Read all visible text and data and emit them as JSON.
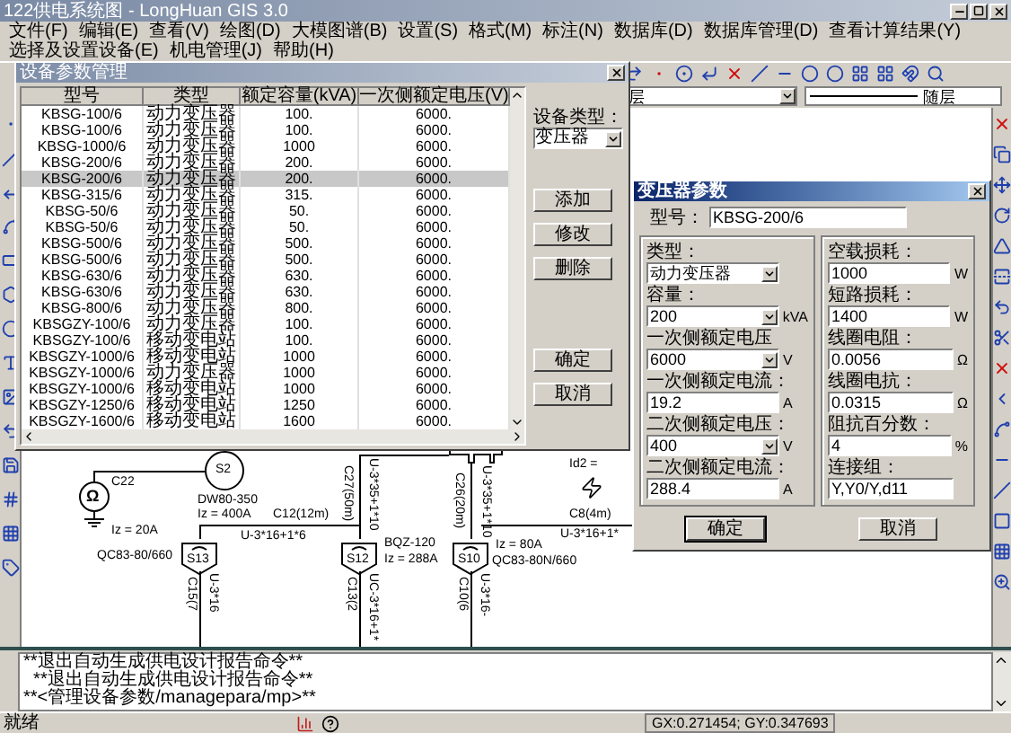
{
  "window": {
    "title": "122供电系统图 - LongHuan GIS 3.0"
  },
  "menu": [
    "文件(F)",
    "编辑(E)",
    "查看(V)",
    "绘图(D)",
    "大模图谱(B)",
    "设置(S)",
    "格式(M)",
    "标注(N)",
    "数据库(D)",
    "数据库管理(D)",
    "查看计算结果(Y)",
    "选择及设置设备(E)",
    "机电管理(J)",
    "帮助(H)"
  ],
  "layer_bar": {
    "layer": "层",
    "linetype": "随层"
  },
  "equipment_dialog": {
    "title": "设备参数管理",
    "columns": [
      "型号",
      "类型",
      "额定容量(kVA)",
      "一次侧额定电压(V)"
    ],
    "rows": [
      {
        "cells": [
          "KBSG-100/6",
          "动力变压器",
          "100.",
          "6000."
        ],
        "selected": false
      },
      {
        "cells": [
          "KBSG-100/6",
          "动力变压器",
          "100.",
          "6000."
        ],
        "selected": false
      },
      {
        "cells": [
          "KBSG-1000/6",
          "动力变压器",
          "1000",
          "6000."
        ],
        "selected": false
      },
      {
        "cells": [
          "KBSG-200/6",
          "动力变压器",
          "200.",
          "6000."
        ],
        "selected": false
      },
      {
        "cells": [
          "KBSG-200/6",
          "动力变压器",
          "200.",
          "6000."
        ],
        "selected": true
      },
      {
        "cells": [
          "KBSG-315/6",
          "动力变压器",
          "315.",
          "6000."
        ],
        "selected": false
      },
      {
        "cells": [
          "KBSG-50/6",
          "动力变压器",
          "50.",
          "6000."
        ],
        "selected": false
      },
      {
        "cells": [
          "KBSG-50/6",
          "动力变压器",
          "50.",
          "6000."
        ],
        "selected": false
      },
      {
        "cells": [
          "KBSG-500/6",
          "动力变压器",
          "500.",
          "6000."
        ],
        "selected": false
      },
      {
        "cells": [
          "KBSG-500/6",
          "动力变压器",
          "500.",
          "6000."
        ],
        "selected": false
      },
      {
        "cells": [
          "KBSG-630/6",
          "动力变压器",
          "630.",
          "6000."
        ],
        "selected": false
      },
      {
        "cells": [
          "KBSG-630/6",
          "动力变压器",
          "630.",
          "6000."
        ],
        "selected": false
      },
      {
        "cells": [
          "KBSG-800/6",
          "动力变压器",
          "800.",
          "6000."
        ],
        "selected": false
      },
      {
        "cells": [
          "KBSGZY-100/6",
          "动力变压器",
          "100.",
          "6000."
        ],
        "selected": false
      },
      {
        "cells": [
          "KBSGZY-100/6",
          "移动变电站",
          "100.",
          "6000."
        ],
        "selected": false
      },
      {
        "cells": [
          "KBSGZY-1000/6",
          "移动变电站",
          "1000",
          "6000."
        ],
        "selected": false
      },
      {
        "cells": [
          "KBSGZY-1000/6",
          "动力变压器",
          "1000",
          "6000."
        ],
        "selected": false
      },
      {
        "cells": [
          "KBSGZY-1000/6",
          "移动变电站",
          "1000",
          "6000."
        ],
        "selected": false
      },
      {
        "cells": [
          "KBSGZY-1250/6",
          "移动变电站",
          "1250",
          "6000."
        ],
        "selected": false
      },
      {
        "cells": [
          "KBSGZY-1600/6",
          "移动变电站",
          "1600",
          "6000."
        ],
        "selected": false
      }
    ],
    "type_label": "设备类型：",
    "type_value": "变压器",
    "buttons": [
      "添加",
      "修改",
      "删除"
    ],
    "footer_buttons": [
      "确定",
      "取消"
    ]
  },
  "transformer_dialog": {
    "title": "变压器参数",
    "model_label": "型号：",
    "model_value": "KBSG-200/6",
    "left_fields": [
      {
        "label": "类型：",
        "value": "动力变压器",
        "kind": "select"
      },
      {
        "label": "容量：",
        "value": "200",
        "unit": "kVA",
        "kind": "select"
      },
      {
        "label": "一次侧额定电压",
        "value": "6000",
        "unit": "V",
        "kind": "select"
      },
      {
        "label": "一次侧额定电流：",
        "value": "19.2",
        "unit": "A",
        "kind": "text"
      },
      {
        "label": "二次侧额定电压：",
        "value": "400",
        "unit": "V",
        "kind": "select"
      },
      {
        "label": "二次侧额定电流：",
        "value": "288.4",
        "unit": "A",
        "kind": "text"
      }
    ],
    "right_fields": [
      {
        "label": "空载损耗：",
        "value": "1000",
        "unit": "W",
        "kind": "text"
      },
      {
        "label": "短路损耗：",
        "value": "1400",
        "unit": "W",
        "kind": "text"
      },
      {
        "label": "线圈电阻：",
        "value": "0.0056",
        "unit": "Ω",
        "kind": "text"
      },
      {
        "label": "线圈电抗：",
        "value": "0.0315",
        "unit": "Ω",
        "kind": "text"
      },
      {
        "label": "阻抗百分数：",
        "value": "4",
        "unit": "%",
        "kind": "text"
      },
      {
        "label": "连接组：",
        "value": "Y,Y0/Y,d11",
        "kind": "text"
      }
    ],
    "buttons": [
      "确定",
      "取消"
    ]
  },
  "diagram": {
    "source": {
      "name": "S2",
      "cable": "C22",
      "switch": "DW80-350",
      "current": "Iz = 400A"
    },
    "meter": {
      "symbol": "Ω"
    },
    "feeders": [
      {
        "cable": "C27(50m)",
        "spec": "U-3*35+1*10"
      },
      {
        "cable": "C26(20m)",
        "spec": "U-3*35+1*10"
      }
    ],
    "fault": {
      "label": "Id2 ="
    },
    "bus": {
      "cable": "C12(12m)",
      "spec": "U-3*16+1*6"
    },
    "bus_right": {
      "cable": "C8(4m)",
      "spec": "U-3*16+1*"
    },
    "switches": [
      {
        "name": "S13",
        "lines": [
          "Iz = 20A",
          "QC83-80/660"
        ],
        "out_cable": "C15(7",
        "out_spec": "U-3*16"
      },
      {
        "name": "S12",
        "lines": [
          "BQZ-120",
          "Iz = 288A"
        ],
        "out_cable": "C13(2",
        "out_spec": "UC-3*16+1*"
      },
      {
        "name": "S10",
        "lines": [
          "Iz = 80A",
          "QC83-80N/660"
        ],
        "out_cable": "C10(6",
        "out_spec": "U-3*16-"
      }
    ]
  },
  "command_log": [
    "**退出自动生成供电设计报告命令**",
    "  **退出自动生成供电设计报告命令**",
    "**<管理设备参数/managepara/mp>**"
  ],
  "status_bar": {
    "status": "就绪",
    "coordinates": "GX:0.271454; GY:0.347693"
  }
}
